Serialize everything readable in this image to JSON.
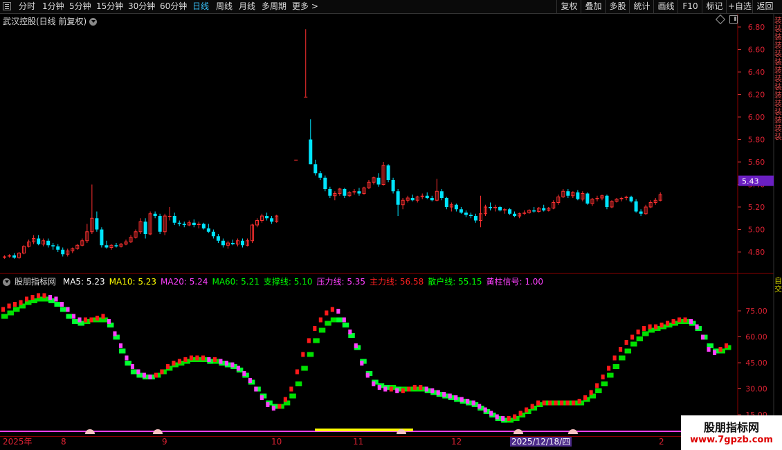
{
  "toolbar": {
    "periods": [
      "分时",
      "1分钟",
      "5分钟",
      "15分钟",
      "30分钟",
      "60分钟",
      "日线",
      "周线",
      "月线",
      "多周期",
      "更多 >"
    ],
    "active_period": "日线",
    "tools": [
      "复权",
      "叠加",
      "多股",
      "统计",
      "画线",
      "F10",
      "标记",
      "+自选",
      "返回"
    ]
  },
  "stock": {
    "title": "武汉控股(日线 前复权)"
  },
  "price_axis": {
    "labels": [
      "6.80",
      "6.60",
      "6.40",
      "6.20",
      "6.00",
      "5.80",
      "5.60",
      "5.40",
      "5.20",
      "5.00",
      "4.80"
    ],
    "current": "5.43",
    "current_color": "#6a1fc2"
  },
  "indicator": {
    "name": "股朋指标网",
    "legend": [
      {
        "text": "MA5: 5.23",
        "color": "#ffffff"
      },
      {
        "text": "MA10: 5.23",
        "color": "#ffff00"
      },
      {
        "text": "MA20: 5.24",
        "color": "#ff40ff"
      },
      {
        "text": "MA60: 5.21",
        "color": "#00ff00"
      },
      {
        "text": "支撑线: 5.10",
        "color": "#00ff00"
      },
      {
        "text": "压力线: 5.35",
        "color": "#ff40ff"
      },
      {
        "text": "主力线: 56.58",
        "color": "#ff2020"
      },
      {
        "text": "散户线: 55.15",
        "color": "#00ff00"
      },
      {
        "text": "黄柱信号: 1.00",
        "color": "#ff40ff"
      }
    ],
    "axis_labels": [
      "75.00",
      "60.00",
      "45.00",
      "30.00",
      "15.00"
    ]
  },
  "time_axis": {
    "labels": [
      "2025年",
      "8",
      "9",
      "10",
      "11",
      "12",
      "2025/12/18/四",
      "2"
    ],
    "highlight": "2025/12/18/四"
  },
  "watermark": {
    "title": "股朋指标网",
    "url": "www.7gpzb.com"
  },
  "right_strip": {
    "top": "装装装装装装装装装装装装装装装",
    "bottom": "自交"
  },
  "colors": {
    "up": "#ff3030",
    "down": "#00e5ff",
    "grid": "#8b0000"
  },
  "chart_data": {
    "type": "candlestick",
    "ohlc": [
      [
        4.75,
        4.77,
        4.74,
        4.76
      ],
      [
        4.76,
        4.78,
        4.75,
        4.77
      ],
      [
        4.77,
        4.79,
        4.74,
        4.75
      ],
      [
        4.75,
        4.8,
        4.74,
        4.79
      ],
      [
        4.79,
        4.86,
        4.78,
        4.85
      ],
      [
        4.85,
        4.91,
        4.84,
        4.89
      ],
      [
        4.89,
        4.95,
        4.87,
        4.92
      ],
      [
        4.92,
        4.95,
        4.86,
        4.87
      ],
      [
        4.87,
        4.92,
        4.85,
        4.9
      ],
      [
        4.9,
        4.92,
        4.84,
        4.86
      ],
      [
        4.86,
        4.88,
        4.82,
        4.85
      ],
      [
        4.85,
        4.87,
        4.8,
        4.82
      ],
      [
        4.82,
        4.84,
        4.76,
        4.78
      ],
      [
        4.78,
        4.83,
        4.76,
        4.81
      ],
      [
        4.81,
        4.84,
        4.79,
        4.83
      ],
      [
        4.83,
        4.87,
        4.82,
        4.86
      ],
      [
        4.86,
        4.92,
        4.85,
        4.9
      ],
      [
        4.9,
        5.05,
        4.88,
        4.98
      ],
      [
        4.98,
        5.4,
        4.96,
        5.1
      ],
      [
        5.1,
        5.16,
        4.98,
        5.0
      ],
      [
        5.0,
        5.02,
        4.84,
        4.86
      ],
      [
        4.86,
        4.9,
        4.83,
        4.84
      ],
      [
        4.84,
        4.87,
        4.82,
        4.86
      ],
      [
        4.86,
        4.88,
        4.84,
        4.85
      ],
      [
        4.85,
        4.88,
        4.84,
        4.87
      ],
      [
        4.87,
        4.91,
        4.86,
        4.89
      ],
      [
        4.89,
        4.95,
        4.88,
        4.93
      ],
      [
        4.93,
        5.0,
        4.92,
        4.98
      ],
      [
        4.98,
        5.1,
        4.96,
        5.07
      ],
      [
        5.07,
        5.1,
        4.92,
        4.96
      ],
      [
        4.96,
        5.16,
        4.95,
        5.14
      ],
      [
        5.14,
        5.16,
        5.1,
        5.12
      ],
      [
        5.12,
        5.14,
        4.96,
        4.98
      ],
      [
        4.98,
        5.14,
        4.95,
        5.12
      ],
      [
        5.12,
        5.2,
        5.08,
        5.12
      ],
      [
        5.12,
        5.15,
        5.04,
        5.06
      ],
      [
        5.06,
        5.08,
        5.03,
        5.05
      ],
      [
        5.05,
        5.07,
        5.02,
        5.04
      ],
      [
        5.04,
        5.08,
        5.03,
        5.06
      ],
      [
        5.06,
        5.09,
        5.02,
        5.04
      ],
      [
        5.04,
        5.07,
        5.01,
        5.05
      ],
      [
        5.05,
        5.06,
        5.0,
        5.01
      ],
      [
        5.01,
        5.05,
        4.97,
        4.98
      ],
      [
        4.98,
        5.0,
        4.92,
        4.94
      ],
      [
        4.94,
        4.96,
        4.88,
        4.9
      ],
      [
        4.9,
        4.92,
        4.84,
        4.86
      ],
      [
        4.86,
        4.9,
        4.83,
        4.88
      ],
      [
        4.88,
        4.91,
        4.86,
        4.87
      ],
      [
        4.87,
        4.92,
        4.85,
        4.9
      ],
      [
        4.9,
        4.92,
        4.84,
        4.86
      ],
      [
        4.86,
        4.92,
        4.85,
        4.9
      ],
      [
        4.9,
        5.05,
        4.88,
        5.04
      ],
      [
        5.04,
        5.1,
        5.02,
        5.08
      ],
      [
        5.08,
        5.14,
        5.06,
        5.12
      ],
      [
        5.12,
        5.15,
        5.08,
        5.1
      ],
      [
        5.1,
        5.12,
        5.05,
        5.07
      ],
      [
        5.07,
        5.13,
        5.06,
        5.12
      ],
      [
        null,
        null,
        null,
        null
      ],
      [
        null,
        null,
        null,
        null
      ],
      [
        null,
        null,
        null,
        null
      ],
      [
        5.62,
        5.62,
        5.62,
        5.62
      ],
      [
        null,
        null,
        null,
        null
      ],
      [
        6.18,
        6.78,
        6.18,
        6.18
      ],
      [
        5.8,
        5.98,
        5.58,
        5.58
      ],
      [
        5.58,
        5.62,
        5.48,
        5.5
      ],
      [
        5.5,
        5.52,
        5.44,
        5.46
      ],
      [
        5.46,
        5.48,
        5.34,
        5.36
      ],
      [
        5.36,
        5.38,
        5.28,
        5.3
      ],
      [
        5.3,
        5.34,
        5.26,
        5.32
      ],
      [
        5.32,
        5.37,
        5.3,
        5.36
      ],
      [
        5.36,
        5.37,
        5.28,
        5.3
      ],
      [
        5.3,
        5.34,
        5.29,
        5.33
      ],
      [
        5.33,
        5.36,
        5.31,
        5.34
      ],
      [
        5.34,
        5.37,
        5.3,
        5.32
      ],
      [
        5.32,
        5.38,
        5.31,
        5.37
      ],
      [
        5.37,
        5.44,
        5.36,
        5.42
      ],
      [
        5.42,
        5.47,
        5.4,
        5.46
      ],
      [
        5.46,
        5.5,
        5.38,
        5.4
      ],
      [
        5.4,
        5.6,
        5.39,
        5.57
      ],
      [
        5.57,
        5.58,
        5.42,
        5.44
      ],
      [
        5.44,
        5.46,
        5.32,
        5.34
      ],
      [
        5.34,
        5.36,
        5.12,
        5.22
      ],
      [
        5.22,
        5.28,
        5.18,
        5.26
      ],
      [
        5.26,
        5.3,
        5.24,
        5.28
      ],
      [
        5.28,
        5.31,
        5.25,
        5.26
      ],
      [
        5.26,
        5.3,
        5.24,
        5.29
      ],
      [
        5.29,
        5.32,
        5.27,
        5.3
      ],
      [
        5.3,
        5.33,
        5.27,
        5.28
      ],
      [
        5.28,
        5.3,
        5.25,
        5.26
      ],
      [
        5.26,
        5.45,
        5.25,
        5.34
      ],
      [
        5.34,
        5.36,
        5.26,
        5.28
      ],
      [
        5.28,
        5.29,
        5.18,
        5.2
      ],
      [
        5.2,
        5.24,
        5.16,
        5.22
      ],
      [
        5.22,
        5.23,
        5.16,
        5.18
      ],
      [
        5.18,
        5.2,
        5.14,
        5.15
      ],
      [
        5.15,
        5.17,
        5.11,
        5.13
      ],
      [
        5.13,
        5.15,
        5.1,
        5.12
      ],
      [
        5.12,
        5.14,
        5.06,
        5.08
      ],
      [
        5.08,
        5.3,
        5.02,
        5.14
      ],
      [
        5.14,
        5.22,
        5.12,
        5.2
      ],
      [
        5.2,
        5.24,
        5.17,
        5.19
      ],
      [
        5.19,
        5.22,
        5.16,
        5.2
      ],
      [
        5.2,
        5.21,
        5.16,
        5.17
      ],
      [
        5.17,
        5.19,
        5.14,
        5.18
      ],
      [
        5.18,
        5.19,
        5.13,
        5.14
      ],
      [
        5.14,
        5.16,
        5.11,
        5.12
      ],
      [
        5.12,
        5.15,
        5.1,
        5.14
      ],
      [
        5.14,
        5.17,
        5.13,
        5.15
      ],
      [
        5.15,
        5.18,
        5.14,
        5.17
      ],
      [
        5.17,
        5.2,
        5.15,
        5.16
      ],
      [
        5.16,
        5.2,
        5.15,
        5.19
      ],
      [
        5.19,
        5.22,
        5.16,
        5.17
      ],
      [
        5.17,
        5.2,
        5.16,
        5.19
      ],
      [
        5.19,
        5.26,
        5.18,
        5.24
      ],
      [
        5.24,
        5.31,
        5.22,
        5.29
      ],
      [
        5.29,
        5.36,
        5.28,
        5.34
      ],
      [
        5.34,
        5.36,
        5.28,
        5.3
      ],
      [
        5.3,
        5.34,
        5.28,
        5.33
      ],
      [
        5.33,
        5.35,
        5.26,
        5.27
      ],
      [
        5.27,
        5.34,
        5.25,
        5.32
      ],
      [
        5.32,
        5.33,
        5.22,
        5.23
      ],
      [
        5.23,
        5.28,
        5.21,
        5.27
      ],
      [
        5.27,
        5.3,
        5.25,
        5.28
      ],
      [
        5.28,
        5.31,
        5.26,
        5.3
      ],
      [
        5.3,
        5.31,
        5.18,
        5.2
      ],
      [
        5.2,
        5.26,
        5.19,
        5.25
      ],
      [
        5.25,
        5.28,
        5.24,
        5.27
      ],
      [
        5.27,
        5.29,
        5.25,
        5.28
      ],
      [
        5.28,
        5.3,
        5.26,
        5.29
      ],
      [
        5.29,
        5.3,
        5.24,
        5.25
      ],
      [
        5.25,
        5.27,
        5.15,
        5.16
      ],
      [
        5.16,
        5.18,
        5.12,
        5.14
      ],
      [
        5.14,
        5.22,
        5.13,
        5.2
      ],
      [
        5.2,
        5.26,
        5.19,
        5.24
      ],
      [
        5.24,
        5.28,
        5.22,
        5.26
      ],
      [
        5.26,
        5.33,
        5.25,
        5.31
      ]
    ],
    "ma5_line": [
      76,
      78,
      79,
      80,
      82,
      83,
      84,
      84,
      83,
      82,
      79,
      76,
      72,
      70,
      70,
      70,
      71,
      72,
      69,
      62,
      55,
      48,
      43,
      40,
      38,
      37,
      38,
      40,
      43,
      45,
      46,
      47,
      48,
      48,
      48,
      47,
      47,
      46,
      45,
      44,
      42,
      39,
      35,
      30,
      25,
      21,
      19,
      20,
      24,
      30,
      40,
      50,
      58,
      65,
      70,
      74,
      76,
      75,
      70,
      63,
      55,
      45,
      38,
      33,
      31,
      30,
      30,
      29,
      29,
      30,
      31,
      31,
      30,
      29,
      28,
      27,
      26,
      25,
      24,
      23,
      22,
      20,
      18,
      16,
      14,
      13,
      13,
      14,
      16,
      18,
      20,
      22,
      22,
      22,
      22,
      22,
      22,
      22,
      23,
      25,
      28,
      32,
      37,
      42,
      48,
      53,
      57,
      60,
      63,
      65,
      66,
      66,
      67,
      68,
      69,
      70,
      70,
      69,
      66,
      60,
      53,
      51,
      53,
      55
    ],
    "ma_alt_line": [
      72,
      74,
      76,
      78,
      80,
      81,
      82,
      82,
      81,
      79,
      76,
      72,
      69,
      68,
      69,
      70,
      70,
      70,
      67,
      60,
      52,
      45,
      40,
      38,
      37,
      37,
      38,
      40,
      42,
      44,
      45,
      46,
      47,
      47,
      47,
      46,
      46,
      45,
      44,
      43,
      41,
      38,
      34,
      30,
      26,
      22,
      20,
      20,
      22,
      26,
      33,
      42,
      50,
      58,
      64,
      68,
      70,
      70,
      67,
      61,
      54,
      46,
      39,
      34,
      32,
      31,
      31,
      30,
      30,
      30,
      30,
      30,
      29,
      28,
      27,
      26,
      25,
      24,
      23,
      22,
      21,
      19,
      17,
      15,
      13,
      12,
      12,
      13,
      15,
      17,
      19,
      21,
      22,
      22,
      22,
      22,
      22,
      22,
      22,
      24,
      26,
      29,
      33,
      38,
      43,
      48,
      52,
      56,
      59,
      62,
      64,
      65,
      66,
      67,
      68,
      69,
      69,
      68,
      65,
      60,
      55,
      52,
      52,
      54
    ],
    "signal_line_value": 1.0
  }
}
